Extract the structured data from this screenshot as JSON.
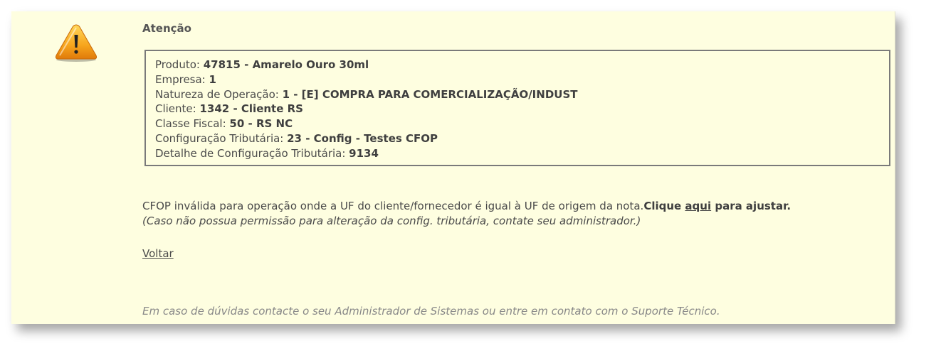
{
  "alert": {
    "icon": "warning-triangle-icon",
    "title": "Atenção",
    "details": [
      {
        "label": "Produto: ",
        "value": "47815 - Amarelo Ouro 30ml"
      },
      {
        "label": "Empresa: ",
        "value": "1"
      },
      {
        "label": "Natureza de Operação: ",
        "value": "1 - [E] COMPRA PARA COMERCIALIZAÇÃO/INDUST"
      },
      {
        "label": "Cliente: ",
        "value": "1342 - Cliente RS"
      },
      {
        "label": "Classe Fiscal: ",
        "value": "50 - RS NC"
      },
      {
        "label": "Configuração Tributária: ",
        "value": "23 - Config - Testes CFOP"
      },
      {
        "label": "Detalhe de Configuração Tributária: ",
        "value": "9134"
      }
    ],
    "message": {
      "text": "CFOP inválida para operação onde a UF do cliente/fornecedor é igual à UF de origem da nota.",
      "action_prefix": "Clique ",
      "action_link": "aqui",
      "action_suffix": " para ajustar.",
      "note": "(Caso não possua permissão para alteração da config. tributária, contate seu administrador.)"
    },
    "back_link": "Voltar",
    "footer": "Em caso de dúvidas contacte o seu Administrador de Sistemas ou entre em contato com o Suporte Técnico."
  },
  "colors": {
    "panel_background": "#fefee0",
    "warning_orange": "#f5a623",
    "border": "#7a7a7a"
  }
}
